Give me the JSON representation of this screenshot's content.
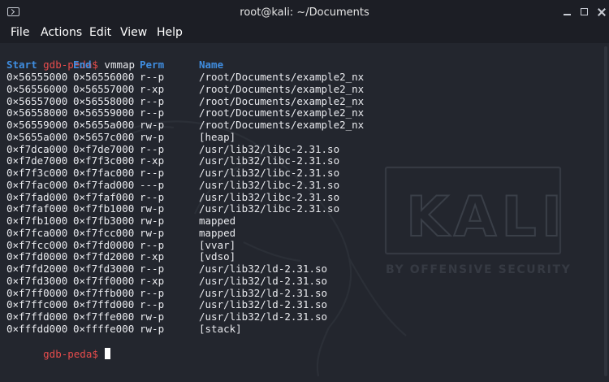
{
  "window": {
    "title": "root@kali: ~/Documents"
  },
  "menu": [
    "File",
    "Actions",
    "Edit",
    "View",
    "Help"
  ],
  "terminal": {
    "prompt": "gdb-peda$",
    "command": "vmmap",
    "headers": [
      "Start",
      "End",
      "Perm",
      "Name"
    ],
    "rows": [
      [
        "0×56555000",
        "0×56556000",
        "r--p",
        "/root/Documents/example2_nx"
      ],
      [
        "0×56556000",
        "0×56557000",
        "r-xp",
        "/root/Documents/example2_nx"
      ],
      [
        "0×56557000",
        "0×56558000",
        "r--p",
        "/root/Documents/example2_nx"
      ],
      [
        "0×56558000",
        "0×56559000",
        "r--p",
        "/root/Documents/example2_nx"
      ],
      [
        "0×56559000",
        "0×5655a000",
        "rw-p",
        "/root/Documents/example2_nx"
      ],
      [
        "0×5655a000",
        "0×5657c000",
        "rw-p",
        "[heap]"
      ],
      [
        "0×f7dca000",
        "0×f7de7000",
        "r--p",
        "/usr/lib32/libc-2.31.so"
      ],
      [
        "0×f7de7000",
        "0×f7f3c000",
        "r-xp",
        "/usr/lib32/libc-2.31.so"
      ],
      [
        "0×f7f3c000",
        "0×f7fac000",
        "r--p",
        "/usr/lib32/libc-2.31.so"
      ],
      [
        "0×f7fac000",
        "0×f7fad000",
        "---p",
        "/usr/lib32/libc-2.31.so"
      ],
      [
        "0×f7fad000",
        "0×f7faf000",
        "r--p",
        "/usr/lib32/libc-2.31.so"
      ],
      [
        "0×f7faf000",
        "0×f7fb1000",
        "rw-p",
        "/usr/lib32/libc-2.31.so"
      ],
      [
        "0×f7fb1000",
        "0×f7fb3000",
        "rw-p",
        "mapped"
      ],
      [
        "0×f7fca000",
        "0×f7fcc000",
        "rw-p",
        "mapped"
      ],
      [
        "0×f7fcc000",
        "0×f7fd0000",
        "r--p",
        "[vvar]"
      ],
      [
        "0×f7fd0000",
        "0×f7fd2000",
        "r-xp",
        "[vdso]"
      ],
      [
        "0×f7fd2000",
        "0×f7fd3000",
        "r--p",
        "/usr/lib32/ld-2.31.so"
      ],
      [
        "0×f7fd3000",
        "0×f7ff0000",
        "r-xp",
        "/usr/lib32/ld-2.31.so"
      ],
      [
        "0×f7ff0000",
        "0×f7ffb000",
        "r--p",
        "/usr/lib32/ld-2.31.so"
      ],
      [
        "0×f7ffc000",
        "0×f7ffd000",
        "r--p",
        "/usr/lib32/ld-2.31.so"
      ],
      [
        "0×f7ffd000",
        "0×f7ffe000",
        "rw-p",
        "/usr/lib32/ld-2.31.so"
      ],
      [
        "0×fffdd000",
        "0×ffffe000",
        "rw-p",
        "[stack]"
      ]
    ]
  },
  "watermark": {
    "logo_text": "KALI",
    "tagline": "BY OFFENSIVE SECURITY"
  },
  "icons": {
    "app": "terminal-icon",
    "minimize": "minimize-icon",
    "maximize": "maximize-icon",
    "close": "close-icon"
  },
  "colors": {
    "background": "#23262e",
    "titlebar": "#1c1e25",
    "prompt": "#e74c4c",
    "header": "#3f8de0",
    "text": "#e9eaee"
  }
}
